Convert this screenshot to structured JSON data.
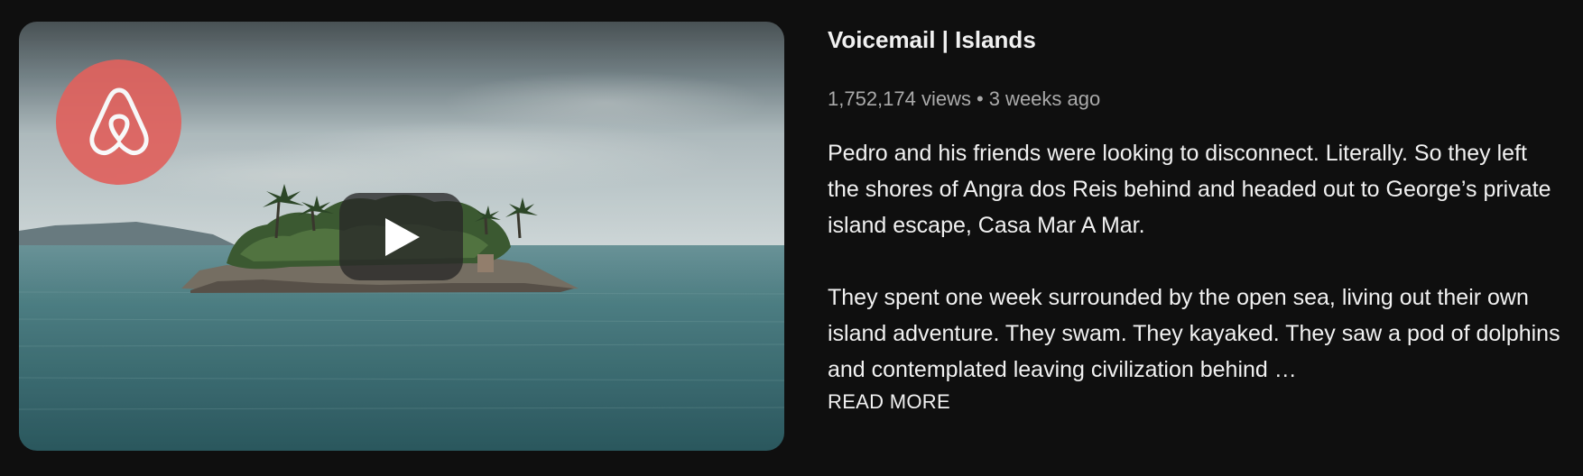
{
  "video": {
    "title": "Voicemail | Islands",
    "views": "1,752,174 views",
    "separator": "•",
    "age": "3 weeks ago",
    "description": [
      "Pedro and his friends were looking to disconnect. Literally. So they left the shores of Angra dos Reis behind and headed out to George’s private island escape, Casa Mar A Mar.",
      "They spent one week surrounded by the open sea, living out their own island adventure. They swam. They kayaked. They saw a pod of dolphins and contemplated leaving civilization behind …"
    ],
    "read_more_label": "READ MORE",
    "thumbnail": {
      "logo_icon": "airbnb-logo-icon",
      "play_icon": "play-icon",
      "badge_color": "#e0625e"
    }
  }
}
